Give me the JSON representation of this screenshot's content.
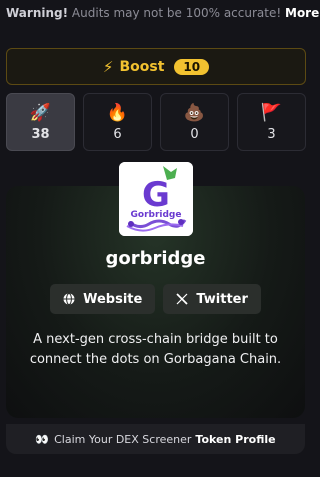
{
  "warning": {
    "label": "Warning!",
    "text": "Audits may not be 100% accurate!",
    "more": "More."
  },
  "boost": {
    "icon": "lightning-icon",
    "label": "Boost",
    "count": "10"
  },
  "reactions": [
    {
      "icon": "rocket-icon",
      "glyph": "🚀",
      "count": "38",
      "active": true
    },
    {
      "icon": "fire-icon",
      "glyph": "🔥",
      "count": "6",
      "active": false
    },
    {
      "icon": "poop-icon",
      "glyph": "💩",
      "count": "0",
      "active": false
    },
    {
      "icon": "red-flag-icon",
      "glyph": "🚩",
      "count": "3",
      "active": false
    }
  ],
  "token": {
    "name": "gorbridge",
    "logo_text": "Gorbridge",
    "logo_letter": "G",
    "description": "A next-gen cross-chain bridge built to connect the dots on Gorbagana Chain."
  },
  "links": {
    "website": "Website",
    "twitter": "Twitter"
  },
  "claim": {
    "prefix": "Claim Your DEX Screener",
    "bold": "Token Profile"
  },
  "colors": {
    "accent": "#f2c230",
    "background": "#141419"
  }
}
